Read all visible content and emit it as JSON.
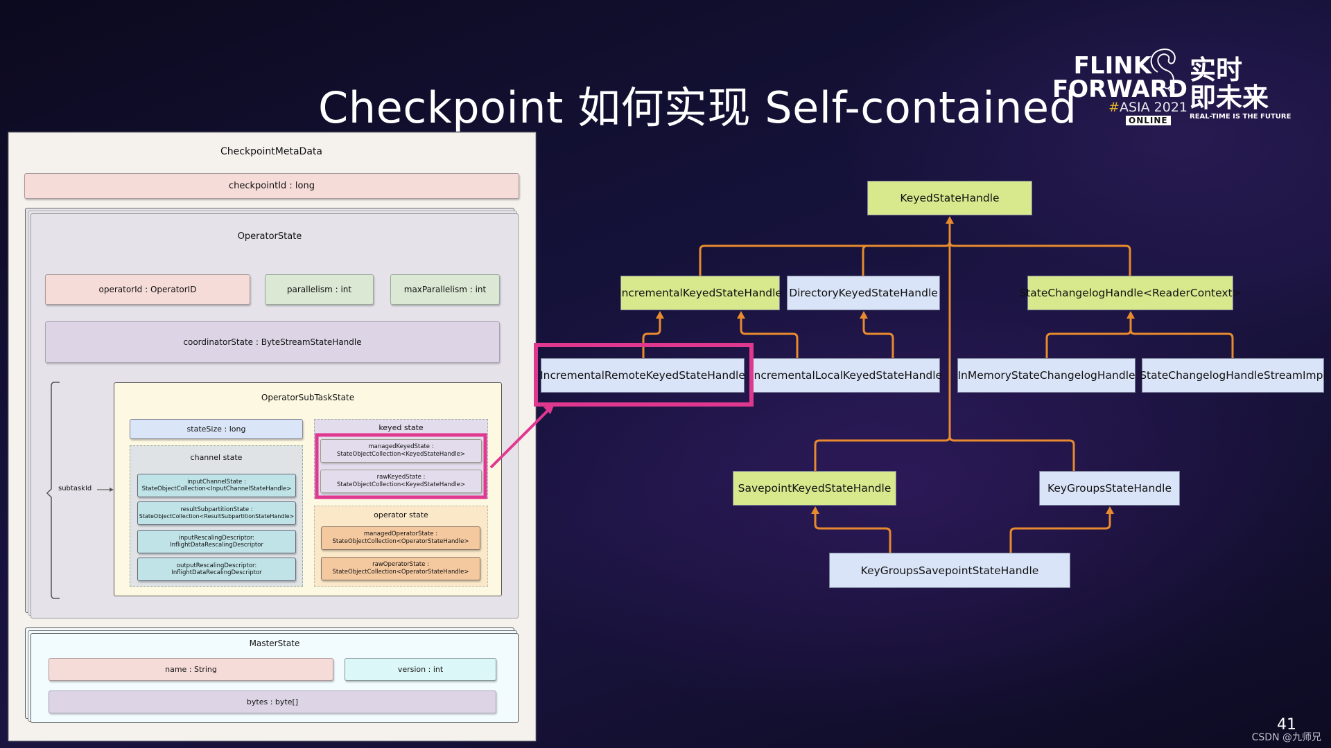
{
  "slide": {
    "title": "Checkpoint 如何实现 Self-contained",
    "page_number": "41",
    "credit": "CSDN @九师兄"
  },
  "logo": {
    "line1": "FLINK",
    "line2": "FORWARD",
    "hash": "#",
    "event": "ASIA 2021",
    "badge": "ONLINE",
    "cn_line1": "实时",
    "cn_line2": "即未来",
    "tagline": "REAL-TIME IS THE FUTURE",
    "icon": "squirrel-icon"
  },
  "colors": {
    "highlight": "#e0388f",
    "arrow": "#e88a2e",
    "node_green": "#d8e88c",
    "node_blue": "#dae4f8"
  },
  "metadata_diagram": {
    "title": "CheckpointMetaData",
    "checkpoint_id": "checkpointId : long",
    "operator_state": {
      "title": "OperatorState",
      "operator_id": "operatorId : OperatorID",
      "parallelism": "parallelism : int",
      "max_parallelism": "maxParallelism : int",
      "coordinator_state": "coordinatorState : ByteStreamStateHandle",
      "subtask_label": "subtaskId",
      "subtask_state": {
        "title": "OperatorSubTaskState",
        "state_size": "stateSize : long",
        "channel_state": {
          "title": "channel state",
          "items": [
            {
              "line1": "inputChannelState :",
              "line2": "StateObjectCollection<InputChannelStateHandle>"
            },
            {
              "line1": "resultSubpartitionState :",
              "line2": "StateObjectCollection<ResultSubpartitionStateHandle>"
            },
            {
              "line1": "inputRescalingDescriptor:",
              "line2": "InflightDataRescalingDescriptor"
            },
            {
              "line1": "outputRescalingDescriptor:",
              "line2": "InflightDataRecalingDescriptor"
            }
          ]
        },
        "keyed_state": {
          "title": "keyed state",
          "items": [
            {
              "line1": "managedKeyedState :",
              "line2": "StateObjectCollection<KeyedStateHandle>"
            },
            {
              "line1": "rawKeyedState :",
              "line2": "StateObjectCollection<KeyedStateHandle>"
            }
          ]
        },
        "operator_state": {
          "title": "operator state",
          "items": [
            {
              "line1": "managedOperatorState :",
              "line2": "StateObjectCollection<OperatorStateHandle>"
            },
            {
              "line1": "rawOperatorState :",
              "line2": "StateObjectCollection<OperatorStateHandle>"
            }
          ]
        }
      }
    },
    "master_state": {
      "title": "MasterState",
      "name": "name : String",
      "version": "version : int",
      "bytes": "bytes : byte[]"
    }
  },
  "hierarchy": {
    "nodes": [
      {
        "id": "keyed",
        "label": "KeyedStateHandle",
        "style": "green"
      },
      {
        "id": "incremental",
        "label": "IncrementalKeyedStateHandle",
        "style": "green"
      },
      {
        "id": "directory",
        "label": "DirectoryKeyedStateHandle",
        "style": "blue"
      },
      {
        "id": "changelog",
        "label": "StateChangelogHandle<ReaderContext>",
        "style": "green"
      },
      {
        "id": "incRemote",
        "label": "IncrementalRemoteKeyedStateHandle",
        "style": "blue",
        "highlighted": true
      },
      {
        "id": "incLocal",
        "label": "IncrementalLocalKeyedStateHandle",
        "style": "blue"
      },
      {
        "id": "inMemory",
        "label": "InMemoryStateChangelogHandle",
        "style": "blue"
      },
      {
        "id": "streamImpl",
        "label": "StateChangelogHandleStreamImpl",
        "style": "blue"
      },
      {
        "id": "savepoint",
        "label": "SavepointKeyedStateHandle",
        "style": "green"
      },
      {
        "id": "keyGroups",
        "label": "KeyGroupsStateHandle",
        "style": "blue"
      },
      {
        "id": "kgSavepoint",
        "label": "KeyGroupsSavepointStateHandle",
        "style": "blue"
      }
    ],
    "edges": [
      {
        "from": "incremental",
        "to": "keyed"
      },
      {
        "from": "directory",
        "to": "keyed"
      },
      {
        "from": "changelog",
        "to": "keyed"
      },
      {
        "from": "savepoint",
        "to": "keyed"
      },
      {
        "from": "keyGroups",
        "to": "keyed"
      },
      {
        "from": "incRemote",
        "to": "incremental"
      },
      {
        "from": "incLocal",
        "to": "incremental"
      },
      {
        "from": "incLocal",
        "to": "directory"
      },
      {
        "from": "inMemory",
        "to": "changelog"
      },
      {
        "from": "streamImpl",
        "to": "changelog"
      },
      {
        "from": "kgSavepoint",
        "to": "savepoint"
      },
      {
        "from": "kgSavepoint",
        "to": "keyGroups"
      }
    ]
  }
}
